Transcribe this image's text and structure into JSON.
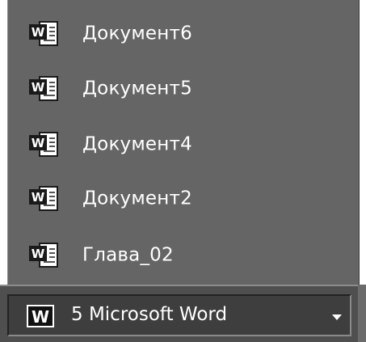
{
  "menu": {
    "items": [
      {
        "label": "Документ6",
        "icon": "word-document-icon"
      },
      {
        "label": "Документ5",
        "icon": "word-document-icon"
      },
      {
        "label": "Документ4",
        "icon": "word-document-icon"
      },
      {
        "label": "Документ2",
        "icon": "word-document-icon"
      },
      {
        "label": "Глава_02",
        "icon": "word-document-icon"
      }
    ]
  },
  "taskbar": {
    "group_button_label": "5 Microsoft Word",
    "group_icon": "word-app-icon",
    "arrow_icon": "dropdown-arrow-icon"
  },
  "colors": {
    "menu_background": "#656565",
    "taskbar_background": "#4f4f4f",
    "text": "#ffffff"
  }
}
